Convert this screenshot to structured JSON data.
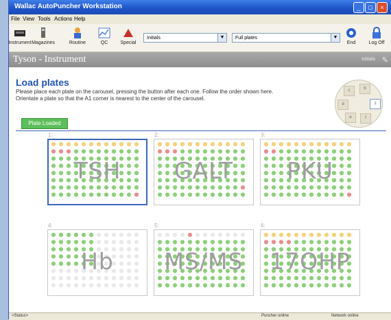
{
  "window": {
    "title": "Wallac AutoPuncher Workstation"
  },
  "menu": [
    "File",
    "View",
    "Tools",
    "Actions",
    "Help"
  ],
  "toolbar": {
    "instrument": "Instrument",
    "magazines": "Magazines",
    "routine": "Routine",
    "qc": "QC",
    "special": "Special",
    "combo1": "Initials",
    "combo2": "Full plates",
    "end": "End",
    "logoff": "Log Off"
  },
  "header": {
    "title": "Tyson - Instrument",
    "initials": "Initials"
  },
  "page": {
    "heading": "Load plates",
    "line1": "Please place each plate on the carousel, pressing the button after each one. Follow the order shown here.",
    "line2": "Orientate a plate so that the A1 corner is nearest to the center of the carousel.",
    "loaded_button": "Plate Loaded"
  },
  "carousel": {
    "active_slot": "1",
    "other_slot_marks": [
      "b",
      "c",
      "d",
      "e",
      "f"
    ]
  },
  "plates": [
    {
      "num": "1:",
      "name": "TSH"
    },
    {
      "num": "2:",
      "name": "GALT"
    },
    {
      "num": "3:",
      "name": "PKU"
    },
    {
      "num": "4:",
      "name": "Hb"
    },
    {
      "num": "5:",
      "name": "MS/MS"
    },
    {
      "num": "6:",
      "name": "17OHP"
    }
  ],
  "status": {
    "left": "<Status>",
    "puncher": "Puncher online",
    "network": "Network online"
  },
  "colors": {
    "well_green": "#8ccf7a",
    "well_yellow": "#f2d27a",
    "well_red": "#e58e8e",
    "well_empty": "#e9e9e9",
    "accent": "#1f57b0"
  }
}
